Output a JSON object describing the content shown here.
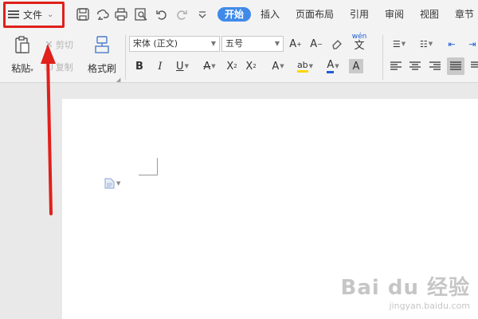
{
  "file_menu": {
    "label": "文件"
  },
  "tabs": [
    {
      "label": "开始",
      "active": true
    },
    {
      "label": "插入"
    },
    {
      "label": "页面布局"
    },
    {
      "label": "引用"
    },
    {
      "label": "审阅"
    },
    {
      "label": "视图"
    },
    {
      "label": "章节"
    }
  ],
  "ribbon": {
    "paste_label": "粘贴",
    "cut_label": "剪切",
    "copy_label": "复制",
    "format_painter_label": "格式刷",
    "font_name": "宋体 (正文)",
    "font_size": "五号",
    "pinyin_glyph": "wén"
  },
  "icons": {
    "quick_access": [
      "save-icon",
      "cloud-icon",
      "print-icon",
      "print-preview-icon",
      "undo-icon",
      "redo-icon",
      "customize-dropdown-icon"
    ],
    "format": [
      "bold-icon",
      "italic-icon",
      "underline-icon",
      "strikethrough-icon",
      "superscript-icon",
      "subscript-icon",
      "text-effect-icon",
      "highlight-icon",
      "font-color-icon",
      "char-shading-icon"
    ],
    "paragraph": [
      "bullets-icon",
      "numbering-icon",
      "decrease-indent-icon",
      "increase-indent-icon",
      "align-left-icon",
      "align-center-icon",
      "align-right-icon",
      "justify-icon",
      "distributed-icon"
    ]
  },
  "colors": {
    "accent": "#3f8ae8",
    "annotation_red": "#e0201b",
    "highlight_yellow": "#ffd700",
    "font_color_blue": "#1f5bd6"
  },
  "watermark": {
    "big": "Bai du 经验",
    "small": "jingyan.baidu.com"
  }
}
